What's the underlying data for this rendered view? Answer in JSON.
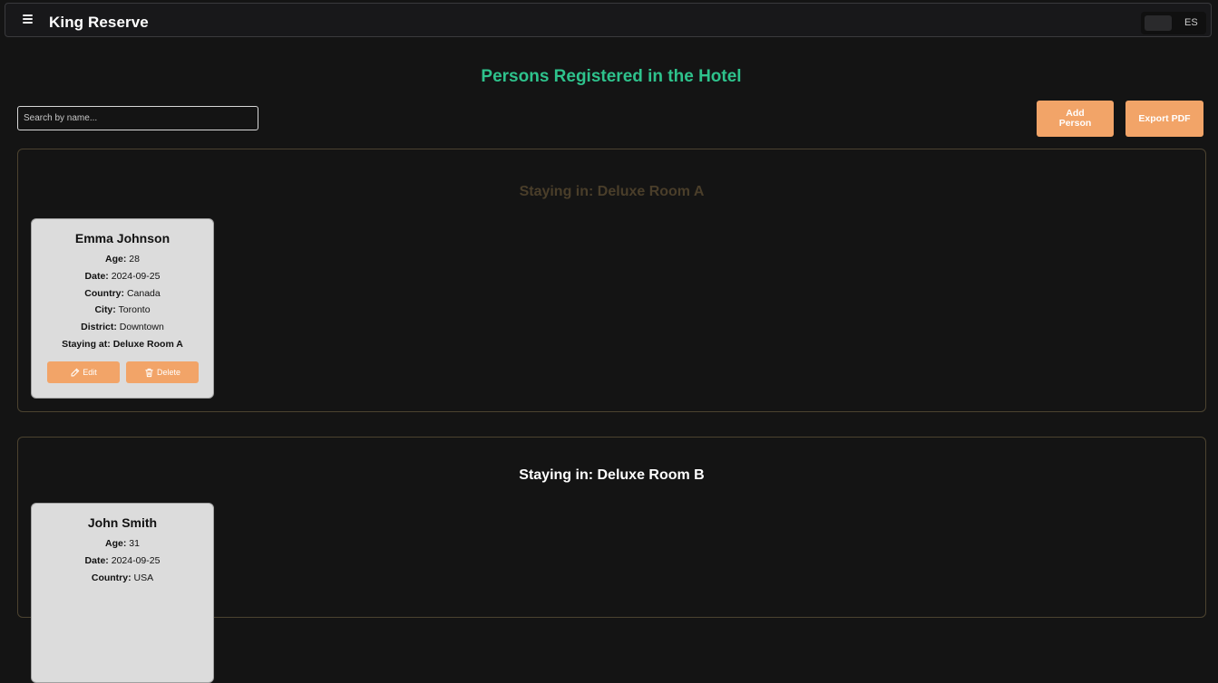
{
  "header": {
    "app_title": "King Reserve",
    "language": "ES"
  },
  "page": {
    "title": "Persons Registered in the Hotel",
    "search_placeholder": "Search by name...",
    "add_person_label": "Add Person",
    "export_pdf_label": "Export PDF"
  },
  "labels": {
    "age": "Age:",
    "date": "Date:",
    "country": "Country:",
    "city": "City:",
    "district": "District:",
    "staying_at": "Staying at:",
    "edit": "Edit",
    "delete": "Delete"
  },
  "rooms": [
    {
      "heading": "Staying in: Deluxe Room A",
      "persons": [
        {
          "name": "Emma Johnson",
          "age": "28",
          "date": "2024-09-25",
          "country": "Canada",
          "city": "Toronto",
          "district": "Downtown",
          "staying_at": "Deluxe Room A"
        }
      ]
    },
    {
      "heading": "Staying in: Deluxe Room B",
      "persons": [
        {
          "name": "John Smith",
          "age": "31",
          "date": "2024-09-25",
          "country": "USA"
        }
      ]
    }
  ],
  "colors": {
    "accent_green": "#2ec28c",
    "button_orange": "#f2a468",
    "background": "#141414",
    "card": "#dcdcdc"
  }
}
